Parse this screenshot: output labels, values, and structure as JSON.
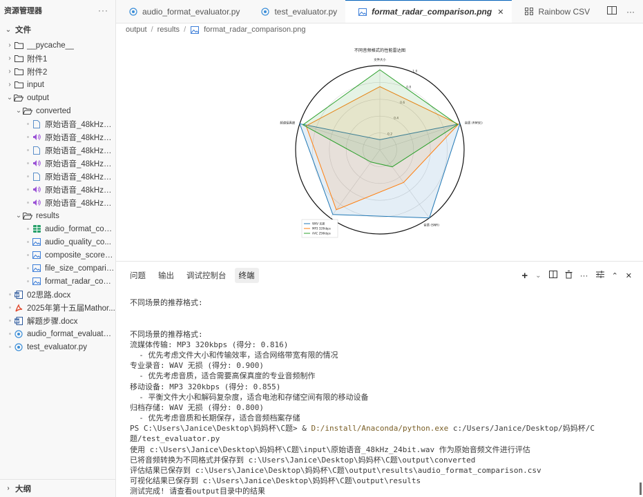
{
  "sidebar": {
    "title": "资源管理器",
    "more": "···",
    "section": "文件",
    "tree": [
      {
        "label": "__pycache__",
        "indent": 0,
        "type": "folder",
        "open": false
      },
      {
        "label": "附件1",
        "indent": 0,
        "type": "folder",
        "open": false
      },
      {
        "label": "附件2",
        "indent": 0,
        "type": "folder",
        "open": false
      },
      {
        "label": "input",
        "indent": 0,
        "type": "folder",
        "open": false
      },
      {
        "label": "output",
        "indent": 0,
        "type": "folder",
        "open": true
      },
      {
        "label": "converted",
        "indent": 1,
        "type": "folder",
        "open": true
      },
      {
        "label": "原始语音_48kHz_2...",
        "indent": 2,
        "type": "file"
      },
      {
        "label": "原始语音_48kHz_2...",
        "indent": 2,
        "type": "audio"
      },
      {
        "label": "原始语音_48kHz_2...",
        "indent": 2,
        "type": "file"
      },
      {
        "label": "原始语音_48kHz_2...",
        "indent": 2,
        "type": "audio"
      },
      {
        "label": "原始语音_48kHz_2...",
        "indent": 2,
        "type": "file"
      },
      {
        "label": "原始语音_48kHz_2...",
        "indent": 2,
        "type": "audio"
      },
      {
        "label": "原始语音_48kHz_2...",
        "indent": 2,
        "type": "audio"
      },
      {
        "label": "results",
        "indent": 1,
        "type": "folder",
        "open": true
      },
      {
        "label": "audio_format_com...",
        "indent": 2,
        "type": "csv"
      },
      {
        "label": "audio_quality_co...",
        "indent": 2,
        "type": "image"
      },
      {
        "label": "composite_score_...",
        "indent": 2,
        "type": "image"
      },
      {
        "label": "file_size_comparis...",
        "indent": 2,
        "type": "image"
      },
      {
        "label": "format_radar_com...",
        "indent": 2,
        "type": "image"
      },
      {
        "label": "02思路.docx",
        "indent": 0,
        "type": "word"
      },
      {
        "label": "2025年第十五届Mathor...",
        "indent": 0,
        "type": "pdf"
      },
      {
        "label": "解题步骤.docx",
        "indent": 0,
        "type": "word"
      },
      {
        "label": "audio_format_evaluator.py",
        "indent": 0,
        "type": "python"
      },
      {
        "label": "test_evaluator.py",
        "indent": 0,
        "type": "python"
      }
    ],
    "outline": "大纲"
  },
  "tabs": [
    {
      "label": "audio_format_evaluator.py",
      "icon": "python-icon",
      "active": false
    },
    {
      "label": "test_evaluator.py",
      "icon": "python-icon",
      "active": false
    },
    {
      "label": "format_radar_comparison.png",
      "icon": "image-icon",
      "active": true
    },
    {
      "label": "Rainbow CSV",
      "icon": "rainbow-csv-icon",
      "active": false
    }
  ],
  "breadcrumb": [
    "output",
    "results",
    "format_radar_comparison.png"
  ],
  "chart_data": {
    "type": "radar",
    "title": "不同音频格式的性能雷达图",
    "axes": [
      "文件大小",
      "音质 (RMSE)",
      "音质 (SNR)",
      "解码复杂度",
      "频谱保真度"
    ],
    "rlim": [
      0,
      1
    ],
    "rticks": [
      "0.2",
      "0.4",
      "0.6",
      "0.8",
      "1.0"
    ],
    "series": [
      {
        "name": "WAV 无损",
        "color": "#1f77b4",
        "values": [
          0.12,
          1.0,
          1.0,
          0.95,
          1.0
        ]
      },
      {
        "name": "MP3 320kbps",
        "color": "#ff7f0e",
        "values": [
          0.75,
          0.98,
          0.48,
          0.88,
          0.92
        ]
      },
      {
        "name": "AAC 256kbps",
        "color": "#2ca02c",
        "values": [
          0.95,
          0.97,
          0.25,
          0.18,
          0.96
        ]
      }
    ],
    "legend": "bottom-left"
  },
  "panel": {
    "tabs": [
      "问题",
      "输出",
      "调试控制台",
      "终端"
    ],
    "active_tab": "终端"
  },
  "terminal": {
    "lines": [
      {
        "text": "不同场景的推荐格式:"
      },
      {
        "text": ""
      },
      {
        "text": ""
      },
      {
        "text": "不同场景的推荐格式:"
      },
      {
        "text": "流媒体传输: MP3 320kbps (得分: 0.816)"
      },
      {
        "text": "  - 优先考虑文件大小和传输效率，适合网络带宽有限的情况"
      },
      {
        "text": "专业录音: WAV 无损 (得分: 0.900)"
      },
      {
        "text": "  - 优先考虑音质，适合需要高保真度的专业音频制作"
      },
      {
        "text": "移动设备: MP3 320kbps (得分: 0.855)"
      },
      {
        "text": "  - 平衡文件大小和解码复杂度，适合电池和存储空间有限的移动设备"
      },
      {
        "text": "归档存储: WAV 无损 (得分: 0.800)"
      },
      {
        "text": "  - 优先考虑音质和长期保存，适合音频档案存储"
      },
      {
        "prefix": "PS C:\\Users\\Janice\\Desktop\\妈妈杯\\C题> & ",
        "highlight": "D:/install/Anaconda/python.exe",
        "suffix": " c:/Users/Janice/Desktop/妈妈杯/C题/test_evaluator.py"
      },
      {
        "text": "使用 c:\\Users\\Janice\\Desktop\\妈妈杯\\C题\\input\\原始语音_48kHz_24bit.wav 作为原始音频文件进行评估"
      },
      {
        "text": "已将音频转换为不同格式并保存到 c:\\Users\\Janice\\Desktop\\妈妈杯\\C题\\output\\converted"
      },
      {
        "text": "评估结果已保存到 c:\\Users\\Janice\\Desktop\\妈妈杯\\C题\\output\\results\\audio_format_comparison.csv"
      },
      {
        "text": "可视化结果已保存到 c:\\Users\\Janice\\Desktop\\妈妈杯\\C题\\output\\results"
      },
      {
        "text": "测试完成! 请查看output目录中的结果"
      },
      {
        "text": "PS C:\\Users\\Janice\\Desktop\\妈妈杯\\C题>"
      }
    ]
  }
}
